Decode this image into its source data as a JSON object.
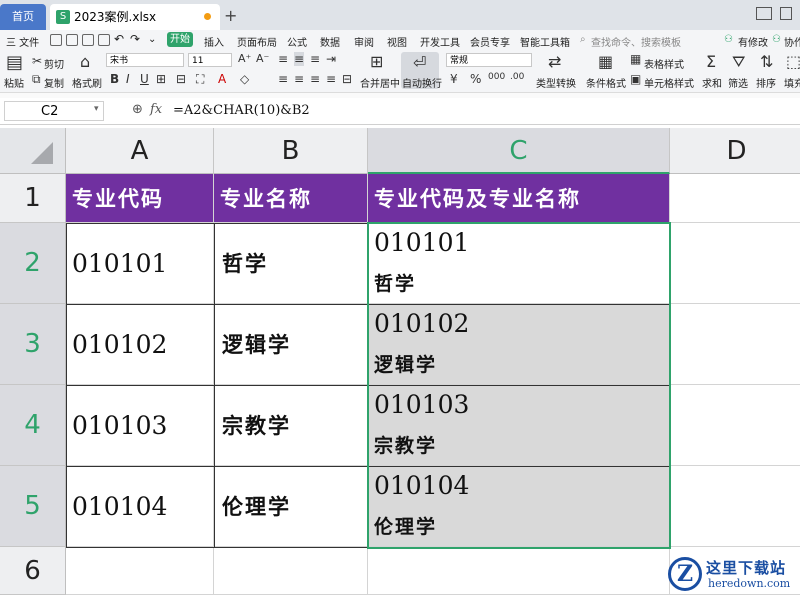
{
  "titlebar": {
    "home_tab": "首页",
    "file_tab": "2023案例.xlsx",
    "new_tab": "+"
  },
  "menubar": {
    "file": "三 文件",
    "start": "开始",
    "items": [
      "插入",
      "页面布局",
      "公式",
      "数据",
      "审阅",
      "视图",
      "开发工具",
      "会员专享",
      "智能工具箱"
    ],
    "search_placeholder": "查找命令、搜索模板",
    "right": [
      "有修改",
      "协作"
    ]
  },
  "toolbar": {
    "cut": "剪切",
    "copy": "复制",
    "paste": "粘贴",
    "format_painter": "格式刷",
    "font_name": "宋书",
    "font_size": "11",
    "merge_center": "合并居中",
    "wrap_text": "自动换行",
    "number_format": "常规",
    "type_convert": "类型转换",
    "conditional_format": "条件格式",
    "table_style": "表格样式",
    "cell_style": "单元格样式",
    "sum": "求和",
    "filter": "筛选",
    "sort": "排序",
    "fill": "填充",
    "bold": "B",
    "italic": "I",
    "underline": "U",
    "currency": "¥",
    "percent": "%"
  },
  "formula_bar": {
    "cell_ref": "C2",
    "fx": "fx",
    "formula": "=A2&CHAR(10)&B2"
  },
  "sheet": {
    "columns": [
      "A",
      "B",
      "C",
      "D"
    ],
    "rows": [
      "1",
      "2",
      "3",
      "4",
      "5",
      "6"
    ],
    "headers": [
      "专业代码",
      "专业名称",
      "专业代码及专业名称"
    ],
    "data": [
      {
        "code": "010101",
        "name": "哲学",
        "combo_code": "010101",
        "combo_name": "哲学"
      },
      {
        "code": "010102",
        "name": "逻辑学",
        "combo_code": "010102",
        "combo_name": "逻辑学"
      },
      {
        "code": "010103",
        "name": "宗教学",
        "combo_code": "010103",
        "combo_name": "宗教学"
      },
      {
        "code": "010104",
        "name": "伦理学",
        "combo_code": "010104",
        "combo_name": "伦理学"
      }
    ]
  },
  "colors": {
    "header_fill": "#7030a0",
    "selection": "#2fa36b",
    "app_accent": "#2fa36b"
  },
  "watermark": {
    "site_cn": "这里下载站",
    "site_en": "heredown.com"
  }
}
